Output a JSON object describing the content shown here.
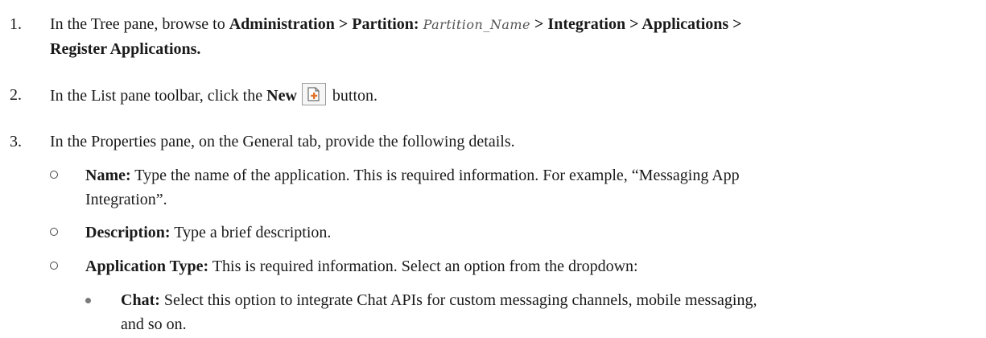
{
  "steps": [
    {
      "number": "1.",
      "prefix": "In the Tree pane, browse to ",
      "path_bold_1": "Administration > Partition:",
      "partition_placeholder": "Partition_Name",
      "path_bold_2": "> Integration > Applications >",
      "path_bold_3": "Register Applications."
    },
    {
      "number": "2.",
      "prefix": "In the List pane toolbar, click the ",
      "bold": "New",
      "icon": "new-document-icon",
      "suffix": "button."
    },
    {
      "number": "3.",
      "text": "In the Properties pane, on the General tab, provide the following details."
    }
  ],
  "fields": [
    {
      "label": "Name:",
      "text_line1": "Type the name of the application. This is required information. For example, “Messaging App",
      "text_line2": "Integration”."
    },
    {
      "label": "Description:",
      "text": "Type a brief description."
    },
    {
      "label": "Application Type:",
      "text": "This is required information. Select an option from the dropdown:"
    }
  ],
  "options": [
    {
      "label": "Chat:",
      "text_line1": "Select this option to integrate Chat APIs for custom messaging channels, mobile messaging,",
      "text_line2": "and so on."
    }
  ],
  "colors": {
    "text": "#1a1a1a",
    "icon_accent": "#e0722a"
  }
}
